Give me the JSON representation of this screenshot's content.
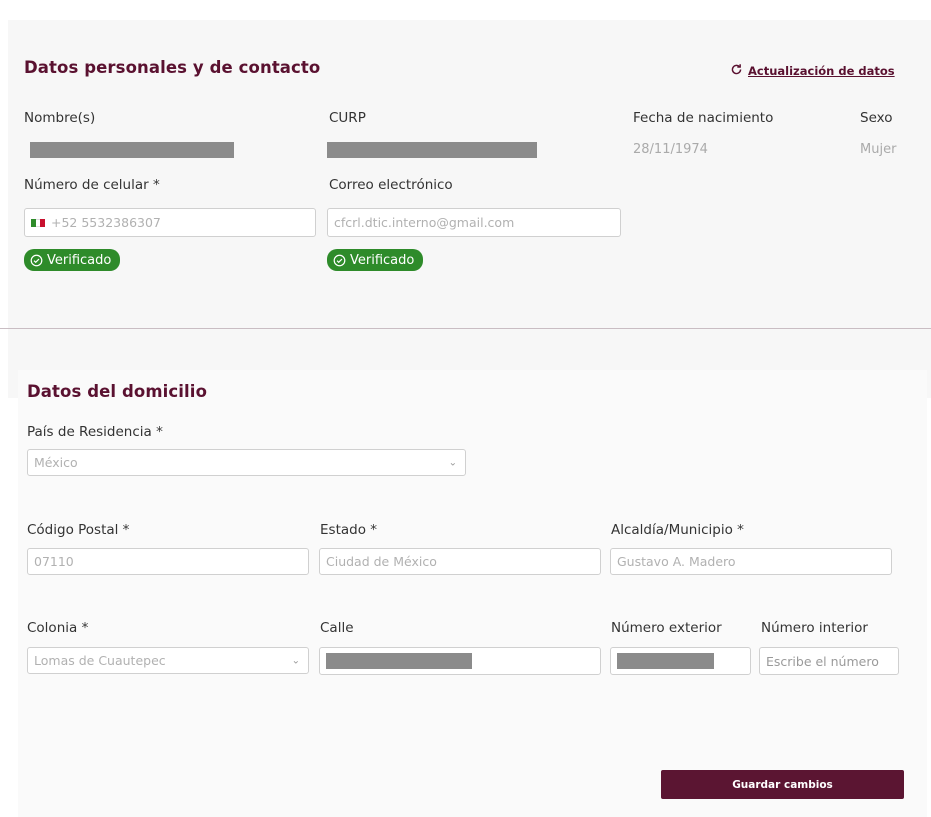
{
  "personal": {
    "title": "Datos personales y de contacto",
    "update_link": "Actualización de datos",
    "labels": {
      "nombre": "Nombre(s)",
      "curp": "CURP",
      "fecha": "Fecha de nacimiento",
      "sexo": "Sexo",
      "celular": "Número de celular *",
      "correo": "Correo electrónico"
    },
    "values": {
      "fecha": "28/11/1974",
      "sexo": "Mujer",
      "celular": "+52 5532386307",
      "correo": "cfcrl.dtic.interno@gmail.com"
    },
    "verified_label": "Verificado"
  },
  "address": {
    "title": "Datos del domicilio",
    "labels": {
      "pais": "País de Residencia *",
      "cp": "Código Postal *",
      "estado": "Estado *",
      "municipio": "Alcaldía/Municipio *",
      "colonia": "Colonia *",
      "calle": "Calle",
      "num_ext": "Número exterior",
      "num_int": "Número interior"
    },
    "values": {
      "pais": "México",
      "cp": "07110",
      "estado": "Ciudad de México",
      "municipio": "Gustavo A. Madero",
      "colonia": "Lomas de Cuautepec"
    },
    "placeholders": {
      "num_int": "Escribe el número"
    }
  },
  "actions": {
    "save": "Guardar cambios"
  },
  "colors": {
    "brand": "#5a1130",
    "verified": "#2e8b2a"
  }
}
